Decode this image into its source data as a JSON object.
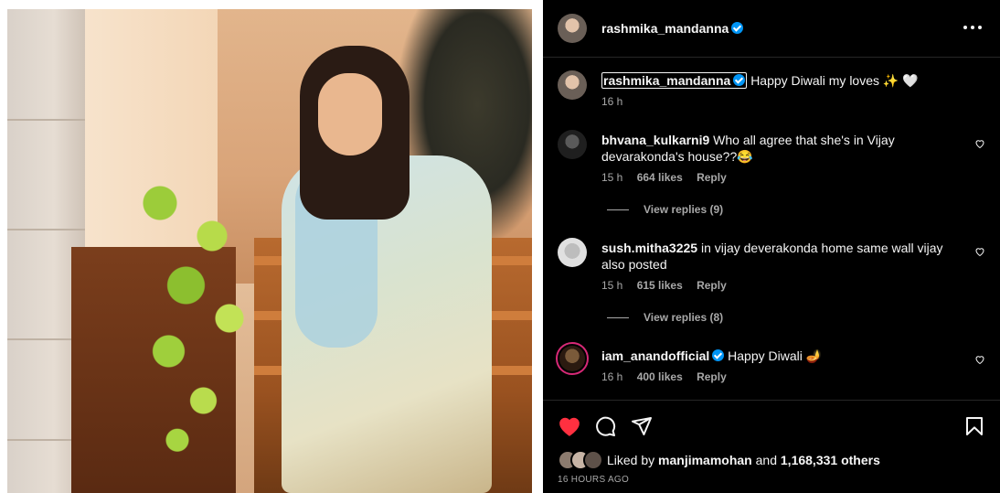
{
  "post": {
    "author": "rashmika_mandanna",
    "verified": true,
    "more_icon": "more-horizontal-icon"
  },
  "caption": {
    "username": "rashmika_mandanna",
    "text": "Happy Diwali my loves ✨ 🤍",
    "time": "16 h"
  },
  "comments": [
    {
      "username": "bhvana_kulkarni9",
      "text": "Who all agree that she's in Vijay devarakonda's house??😂",
      "time": "15 h",
      "likes": "664 likes",
      "reply": "Reply",
      "view_replies": "View replies (9)"
    },
    {
      "username": "sush.mitha3225",
      "text": "in vijay deverakonda home same wall vijay also posted",
      "time": "15 h",
      "likes": "615 likes",
      "reply": "Reply",
      "view_replies": "View replies (8)"
    },
    {
      "username": "iam_anandofficial",
      "verified": true,
      "text": "Happy Diwali 🪔",
      "time": "16 h",
      "likes": "400 likes",
      "reply": "Reply"
    }
  ],
  "actions": {
    "like_icon": "heart-filled-icon",
    "comment_icon": "comment-icon",
    "share_icon": "send-icon",
    "save_icon": "bookmark-icon",
    "like_color": "#ff3040"
  },
  "likes": {
    "prefix": "Liked by",
    "user": "manjimamohan",
    "and": "and",
    "others": "1,168,331 others"
  },
  "timestamp": "16 HOURS AGO"
}
